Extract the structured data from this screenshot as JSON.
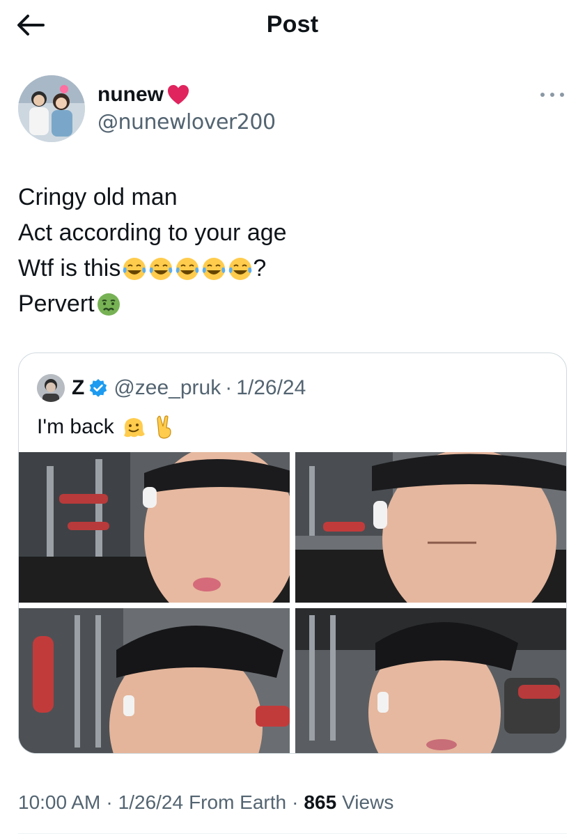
{
  "header": {
    "title": "Post"
  },
  "author": {
    "display_name": "nunew",
    "handle": "@nunewlover200"
  },
  "tweet": {
    "lines": [
      "Cringy old man",
      "Act according to your age",
      "Wtf is this",
      "Pervert"
    ],
    "line3_suffix": "?",
    "emoji_names": [
      "face-with-tears-of-joy",
      "nauseated-face",
      "red-heart"
    ]
  },
  "quote": {
    "display_name": "Z",
    "handle": "@zee_pruk",
    "separator": "·",
    "date": "1/26/24",
    "text": "I'm back",
    "emoji_names": [
      "melting-face",
      "victory-hand"
    ]
  },
  "meta": {
    "time": "10:00 AM",
    "date": "1/26/24",
    "source": "From Earth",
    "views_count": "865",
    "views_label": "Views",
    "separator": "·"
  },
  "colors": {
    "text": "#0f1419",
    "secondary": "#536471",
    "border": "#cfd9de",
    "verified": "#1d9bf0",
    "heart": "#e0245e"
  }
}
